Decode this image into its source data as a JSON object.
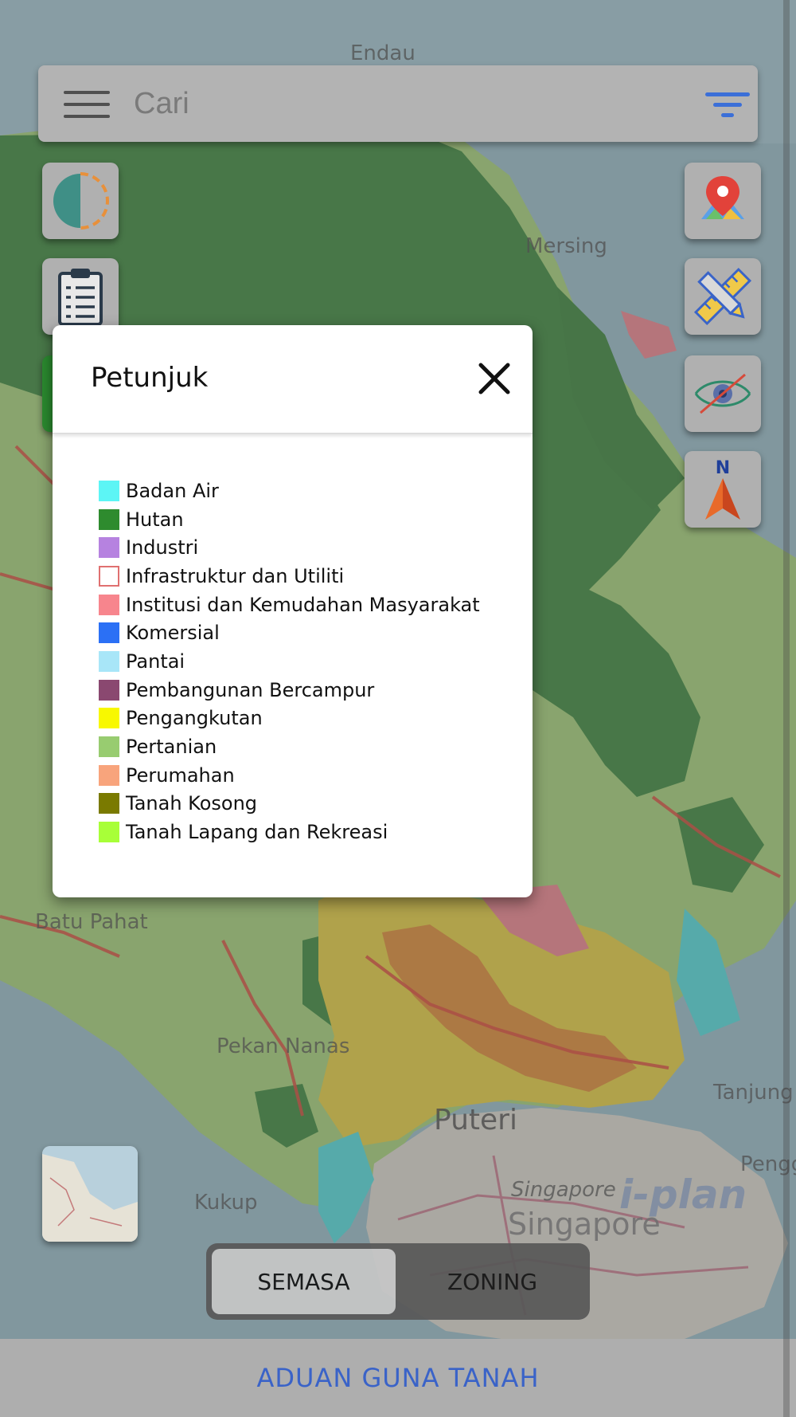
{
  "map": {
    "place_labels": [
      "Endau",
      "Mersing",
      "Batu Pahat",
      "Pekan Nanas",
      "Puteri",
      "Singapore",
      "Singapore",
      "Kukup",
      "Tanjung",
      "Penggerang"
    ]
  },
  "search": {
    "placeholder": "Cari",
    "menu_icon": "hamburger-icon",
    "filter_icon": "filter-icon"
  },
  "left_tools": [
    {
      "icon": "layer-split-icon"
    },
    {
      "icon": "clipboard-list-icon"
    },
    {
      "icon": "layers-tab-icon"
    }
  ],
  "right_tools": [
    {
      "icon": "map-pin-icon"
    },
    {
      "icon": "ruler-pencil-icon"
    },
    {
      "icon": "visibility-eye-icon"
    },
    {
      "icon": "compass-north-icon",
      "label": "N"
    }
  ],
  "legend": {
    "title": "Petunjuk",
    "close_icon": "close-icon",
    "items": [
      {
        "label": "Badan Air",
        "color": "#5cf5f5"
      },
      {
        "label": "Hutan",
        "color": "#2e8b2e"
      },
      {
        "label": "Industri",
        "color": "#b682e0"
      },
      {
        "label": "Infrastruktur dan Utiliti",
        "color": "#ffffff",
        "border": "#e07070"
      },
      {
        "label": "Institusi dan Kemudahan Masyarakat",
        "color": "#f7858d"
      },
      {
        "label": "Komersial",
        "color": "#2b70f5"
      },
      {
        "label": "Pantai",
        "color": "#a8e6f8"
      },
      {
        "label": "Pembangunan Bercampur",
        "color": "#8a4870"
      },
      {
        "label": "Pengangkutan",
        "color": "#f8f800"
      },
      {
        "label": "Pertanian",
        "color": "#98cc70"
      },
      {
        "label": "Perumahan",
        "color": "#f8a47c"
      },
      {
        "label": "Tanah Kosong",
        "color": "#7a7a00"
      },
      {
        "label": "Tanah Lapang dan Rekreasi",
        "color": "#a8ff38"
      }
    ]
  },
  "mode_toggle": {
    "options": [
      "SEMASA",
      "ZONING"
    ],
    "selected": "SEMASA"
  },
  "bottom_bar": {
    "report_label": "ADUAN GUNA TANAH"
  },
  "branding": {
    "logo_text": "i-plan"
  },
  "colors": {
    "accent_blue": "#3a63c8",
    "forest_green": "#2e8b2e"
  }
}
